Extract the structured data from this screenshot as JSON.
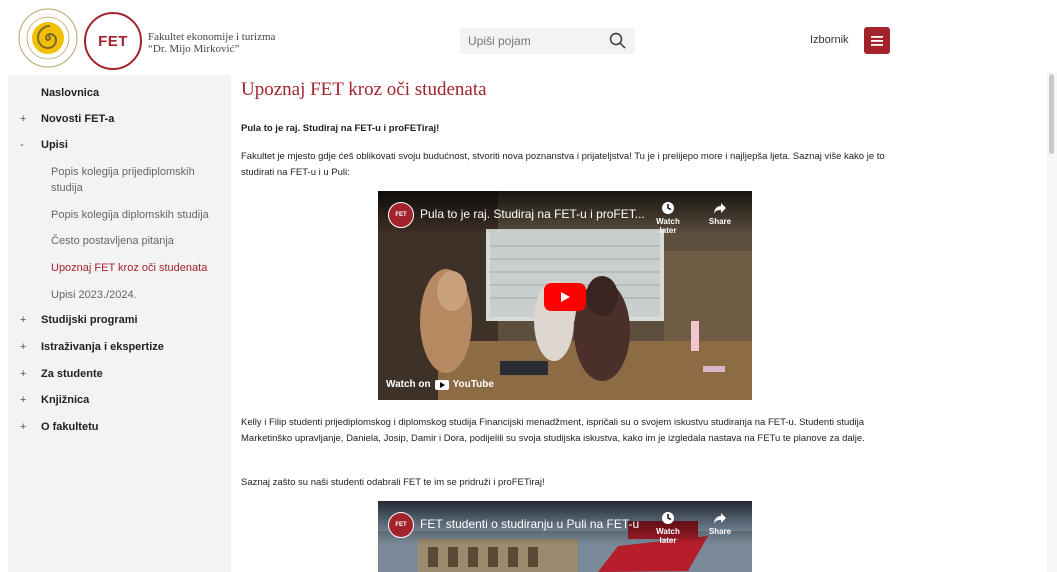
{
  "header": {
    "fet_logo_text": "FET",
    "faculty_name_line1": "Fakultet ekonomije i turizma",
    "faculty_name_line2": "“Dr. Mijo Mirković”",
    "search_placeholder": "Upiši pojam",
    "menu_label": "Izbornik",
    "search_icon": "search-icon",
    "menu_icon": "hamburger-menu-icon"
  },
  "sidebar": {
    "items": [
      {
        "sign": "",
        "label": "Naslovnica"
      },
      {
        "sign": "+",
        "label": "Novosti FET-a"
      },
      {
        "sign": "-",
        "label": "Upisi"
      },
      {
        "sign": "+",
        "label": "Studijski programi"
      },
      {
        "sign": "+",
        "label": "Istraživanja i ekspertize"
      },
      {
        "sign": "+",
        "label": "Za studente"
      },
      {
        "sign": "+",
        "label": "Knjižnica"
      },
      {
        "sign": "+",
        "label": "O fakultetu"
      }
    ],
    "sub_items": [
      {
        "label": "Popis kolegija prijediplomskih studija"
      },
      {
        "label": "Popis kolegija diplomskih studija"
      },
      {
        "label": "Često postavljena pitanja"
      },
      {
        "label": "Upoznaj FET kroz oči studenata"
      },
      {
        "label": "Upisi 2023./2024."
      }
    ]
  },
  "main": {
    "title": "Upoznaj FET kroz oči studenata",
    "intro_bold": "Pula to je raj. Studiraj na FET-u i proFETiraj!",
    "para1": "Fakultet je mjesto gdje ćeš oblikovati svoju budućnost, stvoriti nova poznanstva i prijateljstva! Tu je i prelijepo more i najljepša ljeta. Saznaj više kako je to studirati na FET-u i u Puli:",
    "video1": {
      "channel": "FET",
      "title": "Pula to je raj. Studiraj na FET-u i proFET...",
      "watch_later": "Watch later",
      "share": "Share",
      "watch_on": "Watch on",
      "youtube": "YouTube"
    },
    "para2": "Kelly i Filip studenti prijediplomskog i diplomskog studija Financijski menadžment, ispričali su o svojem iskustvu studiranja na FET-u. Studenti studija Marketinško upravljanje, Daniela, Josip, Damir i Dora, podijelili su svoja studijska iskustva, kako im je izgledala nastava na FETu te planove za dalje.",
    "para3": "Saznaj zašto su naši studenti odabrali FET te im se pridruži i proFETiraj!",
    "video2": {
      "channel": "FET",
      "title": "FET studenti o studiranju u Puli na FET-u",
      "watch_later": "Watch later",
      "share": "Share"
    }
  },
  "colors": {
    "brand": "#a3232c",
    "sidebar_bg": "#f3f3f3"
  }
}
